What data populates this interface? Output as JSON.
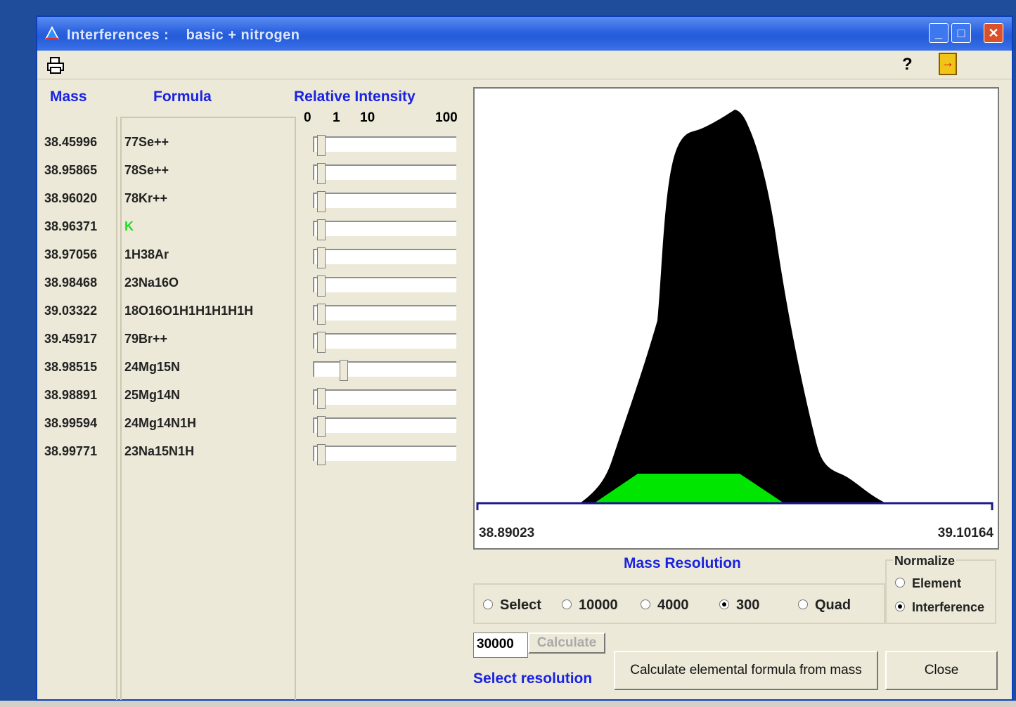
{
  "window": {
    "title_prefix": "Interferences :",
    "title_suffix": "basic + nitrogen",
    "help_label": "?"
  },
  "columns": {
    "mass": "Mass",
    "formula": "Formula",
    "intensity": "Relative Intensity",
    "scale": [
      "0",
      "1",
      "10",
      "100"
    ]
  },
  "rows": [
    {
      "mass": "38.45996",
      "formula": "77Se++",
      "color": "#222222",
      "intensity_fraction": 0.02
    },
    {
      "mass": "38.95865",
      "formula": "78Se++",
      "color": "#222222",
      "intensity_fraction": 0.02
    },
    {
      "mass": "38.96020",
      "formula": "78Kr++",
      "color": "#222222",
      "intensity_fraction": 0.02
    },
    {
      "mass": "38.96371",
      "formula": "K",
      "color": "#22dd22",
      "intensity_fraction": 0.02
    },
    {
      "mass": "38.97056",
      "formula": "1H38Ar",
      "color": "#222222",
      "intensity_fraction": 0.02
    },
    {
      "mass": "38.98468",
      "formula": "23Na16O",
      "color": "#222222",
      "intensity_fraction": 0.02
    },
    {
      "mass": "39.03322",
      "formula": "18O16O1H1H1H1H1H",
      "color": "#222222",
      "intensity_fraction": 0.02
    },
    {
      "mass": "39.45917",
      "formula": "79Br++",
      "color": "#222222",
      "intensity_fraction": 0.02
    },
    {
      "mass": "38.98515",
      "formula": "24Mg15N",
      "color": "#222222",
      "intensity_fraction": 0.18
    },
    {
      "mass": "38.98891",
      "formula": "25Mg14N",
      "color": "#222222",
      "intensity_fraction": 0.02
    },
    {
      "mass": "38.99594",
      "formula": "24Mg14N1H",
      "color": "#222222",
      "intensity_fraction": 0.02
    },
    {
      "mass": "38.99771",
      "formula": "23Na15N1H",
      "color": "#222222",
      "intensity_fraction": 0.02
    }
  ],
  "plot": {
    "x_min": "38.89023",
    "x_max": "39.10164",
    "total_color": "#000000",
    "highlight_color": "#00e600"
  },
  "mass_resolution": {
    "title": "Mass Resolution",
    "options": [
      "Select",
      "10000",
      "4000",
      "300",
      "Quad"
    ],
    "selected": "300"
  },
  "normalize": {
    "title": "Normalize",
    "options": [
      "Element",
      "Interference"
    ],
    "selected": "Interference"
  },
  "resolution_input": {
    "value": "30000"
  },
  "buttons": {
    "calculate": "Calculate",
    "formula_from_mass": "Calculate elemental formula from mass",
    "close": "Close"
  },
  "select_resolution_label": "Select resolution"
}
